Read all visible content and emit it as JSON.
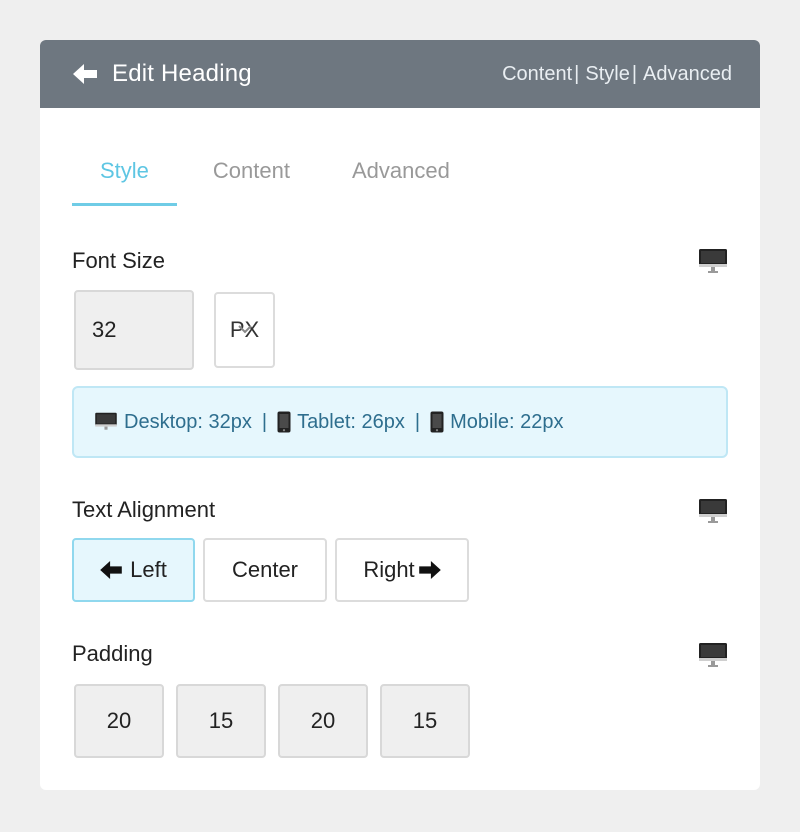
{
  "header": {
    "title": "Edit Heading",
    "links": [
      "Content",
      "Style",
      "Advanced"
    ],
    "separator": "|"
  },
  "tabs": [
    {
      "label": "Style",
      "active": true
    },
    {
      "label": "Content",
      "active": false
    },
    {
      "label": "Advanced",
      "active": false
    }
  ],
  "font_size": {
    "label": "Font Size",
    "value": "32",
    "unit": "PX",
    "device_icon": "desktop-icon"
  },
  "responsive_info": {
    "desktop": "Desktop: 32px",
    "tablet": "Tablet: 26px",
    "mobile": "Mobile: 22px",
    "separator": "|"
  },
  "text_alignment": {
    "label": "Text Alignment",
    "options": [
      {
        "label": "Left",
        "icon": "arrow-left-icon",
        "active": true
      },
      {
        "label": "Center",
        "active": false
      },
      {
        "label": "Right",
        "icon": "arrow-right-icon",
        "active": false
      }
    ],
    "device_icon": "desktop-icon"
  },
  "padding": {
    "label": "Padding",
    "values": [
      "20",
      "15",
      "20",
      "15"
    ],
    "device_icon": "desktop-icon"
  },
  "colors": {
    "header_bg": "#6e7780",
    "accent": "#5ec6e3",
    "info_bg": "#e6f7fd",
    "info_text": "#2e6e8e"
  }
}
